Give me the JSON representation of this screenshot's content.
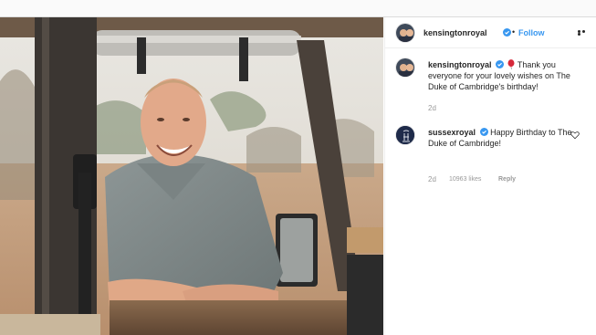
{
  "post": {
    "account": {
      "username": "kensingtonroyal",
      "follow_label": "Follow",
      "separator": "•",
      "verified": true
    },
    "caption": {
      "username": "kensingtonroyal",
      "text": "Thank you everyone for your lovely wishes on The Duke of Cambridge's birthday!",
      "emoji": "balloon-icon",
      "time": "2d"
    },
    "comments": [
      {
        "username": "sussexroyal",
        "verified": true,
        "text": "Happy Birthday to The Duke of Cambridge!",
        "time": "2d",
        "likes": "10963 likes",
        "reply_label": "Reply"
      }
    ]
  },
  "colors": {
    "link_blue": "#3897f0",
    "verified_blue": "#3897f0",
    "muted_text": "#999999",
    "balloon_red": "#d6283a"
  }
}
